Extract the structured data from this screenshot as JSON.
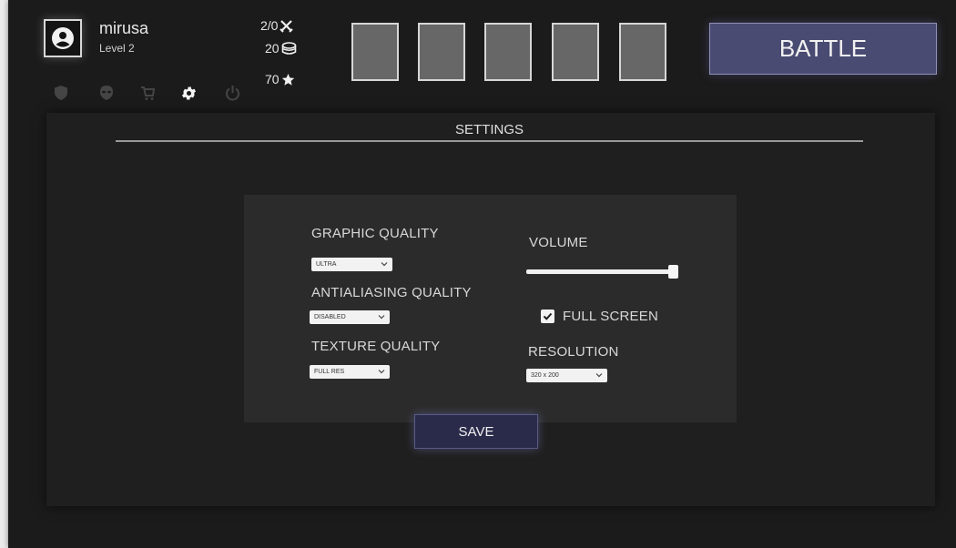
{
  "player": {
    "name": "mirusa",
    "level": "Level 2"
  },
  "stats": {
    "wins_losses": "2/0",
    "coins": "20",
    "stars": "70"
  },
  "nav": [
    "shield-icon",
    "alien-icon",
    "cart-icon",
    "gear-icon",
    "power-icon"
  ],
  "card_slots": 5,
  "battle_label": "BATTLE",
  "settings": {
    "title": "SETTINGS",
    "graphic_quality": {
      "label": "GRAPHIC QUALITY",
      "value": "ULTRA"
    },
    "antialiasing": {
      "label": "ANTIALIASING QUALITY",
      "value": "DISABLED"
    },
    "texture": {
      "label": "TEXTURE QUALITY",
      "value": "FULL RES"
    },
    "volume": {
      "label": "VOLUME",
      "level": 1.0
    },
    "fullscreen": {
      "label": "FULL SCREEN",
      "checked": true
    },
    "resolution": {
      "label": "RESOLUTION",
      "value": "320 x 200"
    },
    "save_label": "SAVE"
  },
  "colors": {
    "accent": "#4a4b72",
    "save_bg": "#2a2b4a",
    "panel": "#1f1f1f"
  }
}
